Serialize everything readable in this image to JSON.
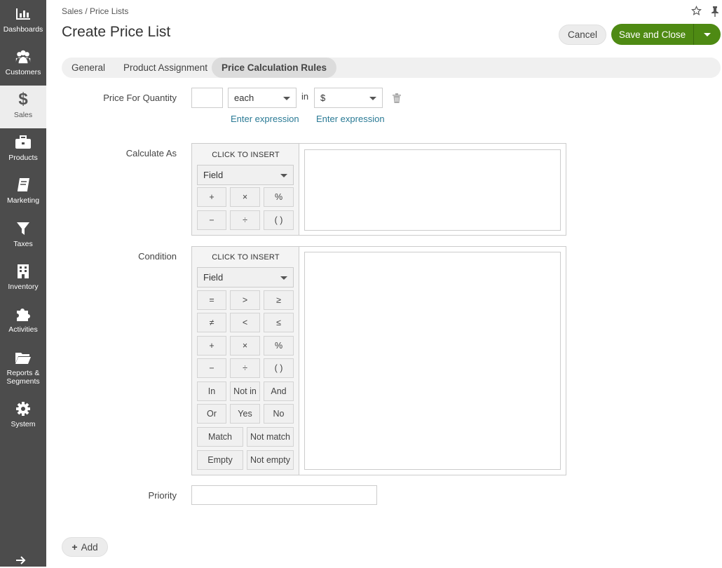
{
  "sidebar": {
    "items": [
      {
        "label": "Dashboards",
        "icon": "dashboards-icon"
      },
      {
        "label": "Customers",
        "icon": "customers-icon"
      },
      {
        "label": "Sales",
        "icon": "dollar-icon",
        "active": true
      },
      {
        "label": "Products",
        "icon": "briefcase-icon"
      },
      {
        "label": "Marketing",
        "icon": "book-icon"
      },
      {
        "label": "Taxes",
        "icon": "filter-icon"
      },
      {
        "label": "Inventory",
        "icon": "building-icon"
      },
      {
        "label": "Activities",
        "icon": "puzzle-icon"
      },
      {
        "label": "Reports &",
        "label2": "Segments",
        "icon": "folder-icon"
      },
      {
        "label": "System",
        "icon": "gear-icon"
      }
    ],
    "collapse_icon": "arrow-right-icon"
  },
  "header": {
    "breadcrumb": "Sales / Price Lists",
    "title": "Create Price List",
    "cancel_label": "Cancel",
    "save_label": "Save and Close"
  },
  "tabs": [
    {
      "label": "General"
    },
    {
      "label": "Product Assignment"
    },
    {
      "label": "Price Calculation Rules",
      "active": true
    }
  ],
  "form": {
    "price_for_quantity_label": "Price For Quantity",
    "quantity_value": "",
    "unit_value": "each",
    "in_label": "in",
    "currency_value": "$",
    "enter_expression_1": "Enter expression",
    "enter_expression_2": "Enter expression",
    "calculate_as_label": "Calculate As",
    "condition_label": "Condition",
    "priority_label": "Priority",
    "priority_value": "",
    "click_to_insert": "CLICK TO INSERT",
    "field_select": "Field",
    "calc_ops": [
      "+",
      "×",
      "%",
      "−",
      "÷",
      "( )"
    ],
    "cond_ops": [
      "=",
      ">",
      "≥",
      "≠",
      "<",
      "≤",
      "+",
      "×",
      "%",
      "−",
      "÷",
      "( )",
      "In",
      "Not in",
      "And",
      "Or",
      "Yes",
      "No"
    ],
    "cond_wide_ops": [
      "Match",
      "Not match",
      "Empty",
      "Not empty"
    ],
    "calculate_as_value": "",
    "condition_value": ""
  },
  "add_label": "Add"
}
